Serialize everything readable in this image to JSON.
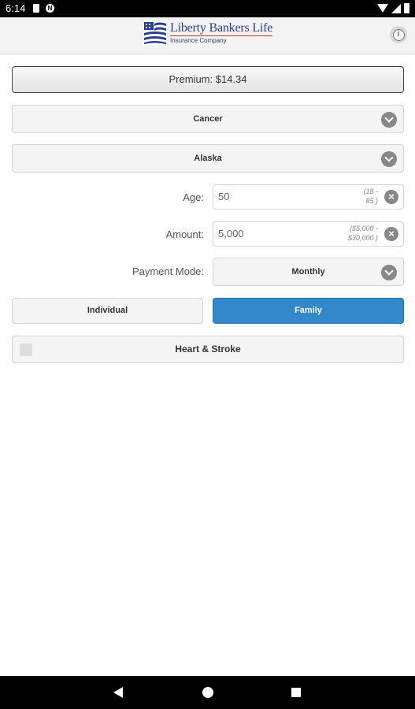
{
  "status_bar": {
    "time": "6:14"
  },
  "header": {
    "logo_name": "Liberty Bankers Life",
    "logo_sub": "Insurance Company",
    "info_icon": "info-icon"
  },
  "premium": {
    "label": "Premium: $14.34"
  },
  "product_select": {
    "value": "Cancer"
  },
  "state_select": {
    "value": "Alaska"
  },
  "age": {
    "label": "Age:",
    "value": "50",
    "hint_line1": "(18 -",
    "hint_line2": "85 )"
  },
  "amount": {
    "label": "Amount:",
    "value": "5,000",
    "hint_line1": "($5,000 -",
    "hint_line2": "$30,000 )"
  },
  "payment_mode": {
    "label": "Payment Mode:",
    "value": "Monthly"
  },
  "coverage": {
    "individual": "Individual",
    "family": "Family",
    "selected": "Family"
  },
  "rider": {
    "label": "Heart & Stroke",
    "checked": false
  },
  "colors": {
    "accent": "#3388cc",
    "brand": "#2a3f8f"
  }
}
